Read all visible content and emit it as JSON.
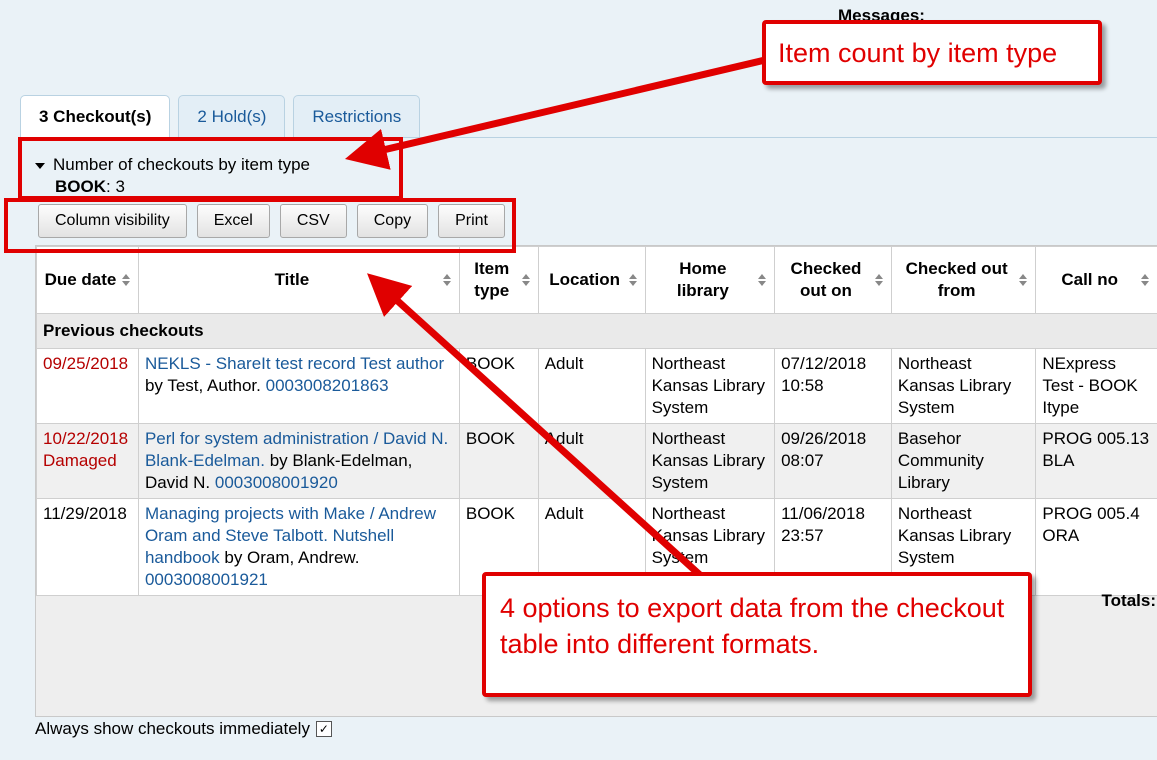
{
  "messages_label": "Messages:",
  "tabs": [
    {
      "label": "3 Checkout(s)",
      "active": true
    },
    {
      "label": "2 Hold(s)",
      "active": false
    },
    {
      "label": "Restrictions",
      "active": false
    }
  ],
  "summary": {
    "toggle_label": "Number of checkouts by item type",
    "item_type": "BOOK",
    "count": "3"
  },
  "export_buttons": [
    "Column visibility",
    "Excel",
    "CSV",
    "Copy",
    "Print"
  ],
  "table": {
    "headers": [
      "Due date",
      "Title",
      "Item type",
      "Location",
      "Home library",
      "Checked out on",
      "Checked out from",
      "Call no"
    ],
    "group_label": "Previous checkouts",
    "rows": [
      {
        "due_date": "09/25/2018",
        "due_status": "",
        "title_link": "NEKLS - ShareIt test record Test author",
        "author_text": " by Test, Author. ",
        "barcode": "0003008201863",
        "item_type": "BOOK",
        "location": "Adult",
        "home_library": "Northeast Kansas Library System",
        "checked_out_on": "07/12/2018 10:58",
        "checked_out_from": "Northeast Kansas Library System",
        "call_no": "NExpress Test - BOOK Itype"
      },
      {
        "due_date": "10/22/2018",
        "due_status": "Damaged",
        "title_link": "Perl for system administration / David N. Blank-Edelman.",
        "author_text": " by Blank-Edelman, David N. ",
        "barcode": "0003008001920",
        "item_type": "BOOK",
        "location": "Adult",
        "home_library": "Northeast Kansas Library System",
        "checked_out_on": "09/26/2018 08:07",
        "checked_out_from": "Basehor Community Library",
        "call_no": "PROG 005.13 BLA"
      },
      {
        "due_date": "11/29/2018",
        "due_status": "",
        "title_link": "Managing projects with Make / Andrew Oram and Steve Talbott. Nutshell handbook",
        "author_text": " by Oram, Andrew. ",
        "barcode": "0003008001921",
        "item_type": "BOOK",
        "location": "Adult",
        "home_library": "Northeast Kansas Library System",
        "checked_out_on": "11/06/2018 23:57",
        "checked_out_from": "Northeast Kansas Library System",
        "call_no": "PROG 005.4 ORA"
      }
    ],
    "totals_label": "Totals:"
  },
  "always_show_label": "Always show checkouts immediately",
  "always_show_checked": true,
  "annotations": {
    "callout_item_count": "Item count by item type",
    "callout_export": "4 options to export data from the checkout table into different formats."
  },
  "colors": {
    "annotation_red": "#e00000",
    "link_blue": "#1a5a9a",
    "overdue_red": "#b50000"
  }
}
